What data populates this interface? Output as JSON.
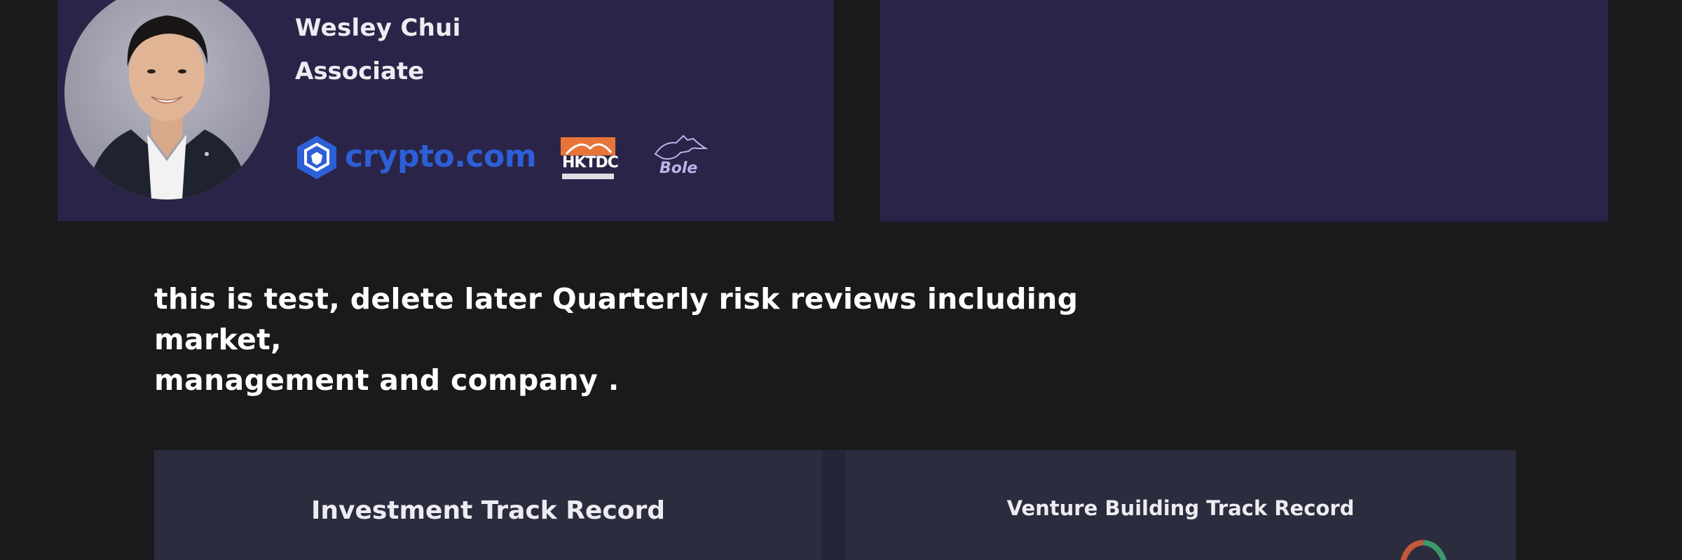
{
  "profile": {
    "name": "Wesley Chui",
    "role": "Associate",
    "logos": {
      "crypto": "crypto.com",
      "hktdc": "HKTDC",
      "bole": "Bole"
    }
  },
  "description": {
    "line1": "this is test, delete later Quarterly risk reviews including market,",
    "line2": "management and company ."
  },
  "track_records": {
    "investment_title": "Investment Track Record",
    "venture_title": "Venture Building Track Record"
  },
  "colors": {
    "background": "#1a1a1c",
    "card": "#2a2548",
    "track_card": "#2b2c3d",
    "crypto_blue": "#2d5fd6",
    "hktdc_orange": "#e8743a"
  }
}
